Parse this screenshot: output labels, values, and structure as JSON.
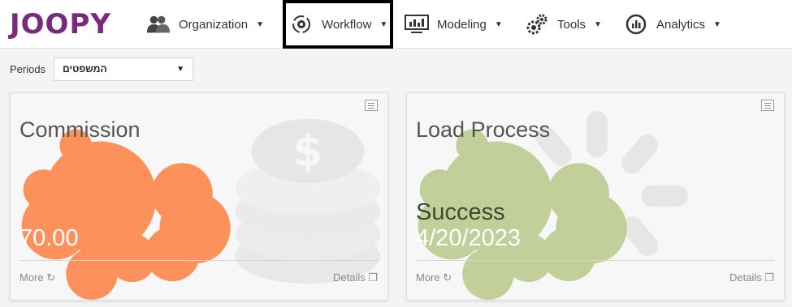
{
  "app": {
    "logo": "JOOPY"
  },
  "nav": [
    {
      "label": "Organization",
      "icon": "users-icon"
    },
    {
      "label": "Workflow",
      "icon": "workflow-cog-icon",
      "active": true
    },
    {
      "label": "Modeling",
      "icon": "monitor-chart-icon"
    },
    {
      "label": "Tools",
      "icon": "gears-icon"
    },
    {
      "label": "Analytics",
      "icon": "analytics-icon"
    }
  ],
  "filters": {
    "periods_label": "Periods",
    "periods_value": "המשפטים"
  },
  "cards": [
    {
      "title": "Commission",
      "value": "70.00",
      "more_label": "More",
      "details_label": "Details",
      "color": "#ff7b3a",
      "icon": "coins-icon"
    },
    {
      "title": "Load Process",
      "status": "Success",
      "value": "4/20/2023",
      "more_label": "More",
      "details_label": "Details",
      "color": "#b9c98a",
      "icon": "loading-spinner-icon"
    }
  ],
  "colors": {
    "brand": "#7a2a7d",
    "active_outline": "#000000"
  }
}
